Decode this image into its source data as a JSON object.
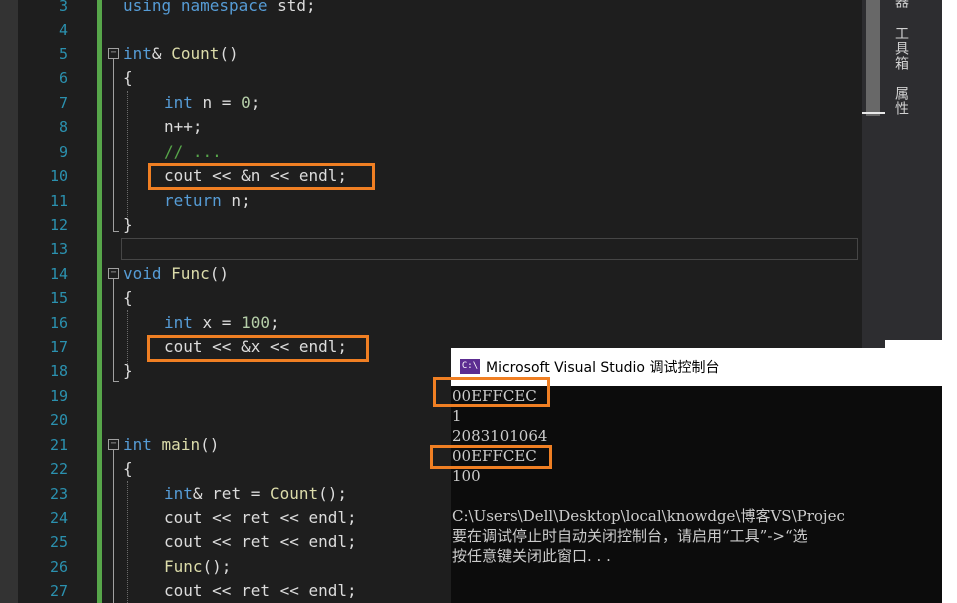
{
  "line_numbers": [
    "3",
    "4",
    "5",
    "6",
    "7",
    "8",
    "9",
    "10",
    "11",
    "12",
    "13",
    "14",
    "15",
    "16",
    "17",
    "18",
    "19",
    "20",
    "21",
    "22",
    "23",
    "24",
    "25",
    "26",
    "27"
  ],
  "code": {
    "l3": {
      "kw": "using",
      "ns": "namespace",
      "rest": " std;"
    },
    "l5": {
      "ret_type": "int",
      "ref": "&",
      "fn": "Count",
      "paren": "()"
    },
    "l6": "{",
    "l7": {
      "kw": "int",
      "name": " n = ",
      "num": "0",
      "end": ";"
    },
    "l8": "n++;",
    "l9": "// ...",
    "l10": "cout << &n << endl;",
    "l11": {
      "kw": "return",
      "rest": " n;"
    },
    "l12": "}",
    "l14": {
      "kw": "void",
      "fn": "Func",
      "paren": "()"
    },
    "l15": "{",
    "l16": {
      "kw": "int",
      "name": " x = ",
      "num": "100",
      "end": ";"
    },
    "l17": "cout << &x << endl;",
    "l18": "}",
    "l21": {
      "kw": "int",
      "fn": "main",
      "paren": "()"
    },
    "l22": "{",
    "l23": {
      "kw": "int",
      "ref": "& ",
      "var": "ret",
      "mid": " = ",
      "fn": "Count",
      "end": "();"
    },
    "l24": "cout << ret << endl;",
    "l25": "cout << ret << endl;",
    "l26": {
      "fn": "Func",
      "end": "();"
    },
    "l27": "cout << ret << endl;"
  },
  "sidebar": {
    "tab_toolbox": "工具箱",
    "tab_properties": "属性",
    "tab_top": "器"
  },
  "console": {
    "title": "Microsoft Visual Studio 调试控制台",
    "icon_label": "C:\\",
    "lines": [
      "00EFFCEC",
      "1",
      "2083101064",
      "00EFFCEC",
      "100",
      "",
      "C:\\Users\\Dell\\Desktop\\local\\knowdge\\博客VS\\Projec",
      "要在调试停止时自动关闭控制台，请启用“工具”->“选",
      "按任意键关闭此窗口. . ."
    ]
  },
  "colors": {
    "highlight_box": "#f07f23",
    "keyword": "#569cd6",
    "function": "#dcdcaa",
    "number": "#b5cea8",
    "comment": "#57a64a",
    "line_number": "#2b91af"
  }
}
